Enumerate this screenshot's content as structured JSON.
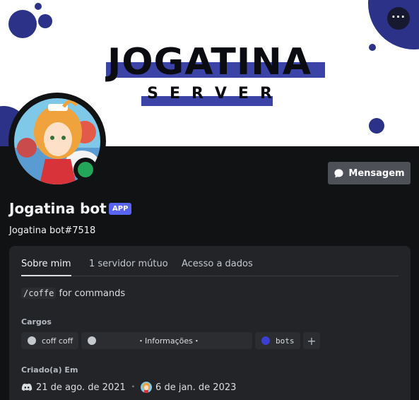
{
  "banner": {
    "title": "JOGATINA",
    "subtitle": "SERVER",
    "more_icon": "ellipsis-icon"
  },
  "profile": {
    "username": "Jogatina bot",
    "badge": "APP",
    "tag": "Jogatina bot#7518",
    "status": "online",
    "message_button": "Mensagem"
  },
  "tabs": [
    "Sobre mim",
    "1 servidor mútuo",
    "Acesso a dados"
  ],
  "about": {
    "command": "/coffe",
    "text": " for commands"
  },
  "roles_section": {
    "title": "Cargos",
    "roles": [
      {
        "label": "coff coff",
        "color": "#c4c9ce"
      },
      {
        "label": "・Informações・",
        "color": "#c4c9ce"
      },
      {
        "label": "bots",
        "color": "#3b3fd1"
      }
    ],
    "add_label": "+"
  },
  "created_section": {
    "title": "Criado(a) Em",
    "discord_date": "21 de ago. de 2021",
    "server_date": "6 de jan. de 2023",
    "bullet": "•"
  },
  "colors": {
    "background": "#111214",
    "card": "#232428",
    "accent": "#5865f2",
    "online": "#23a55a",
    "banner_blue": "#2b3287"
  }
}
